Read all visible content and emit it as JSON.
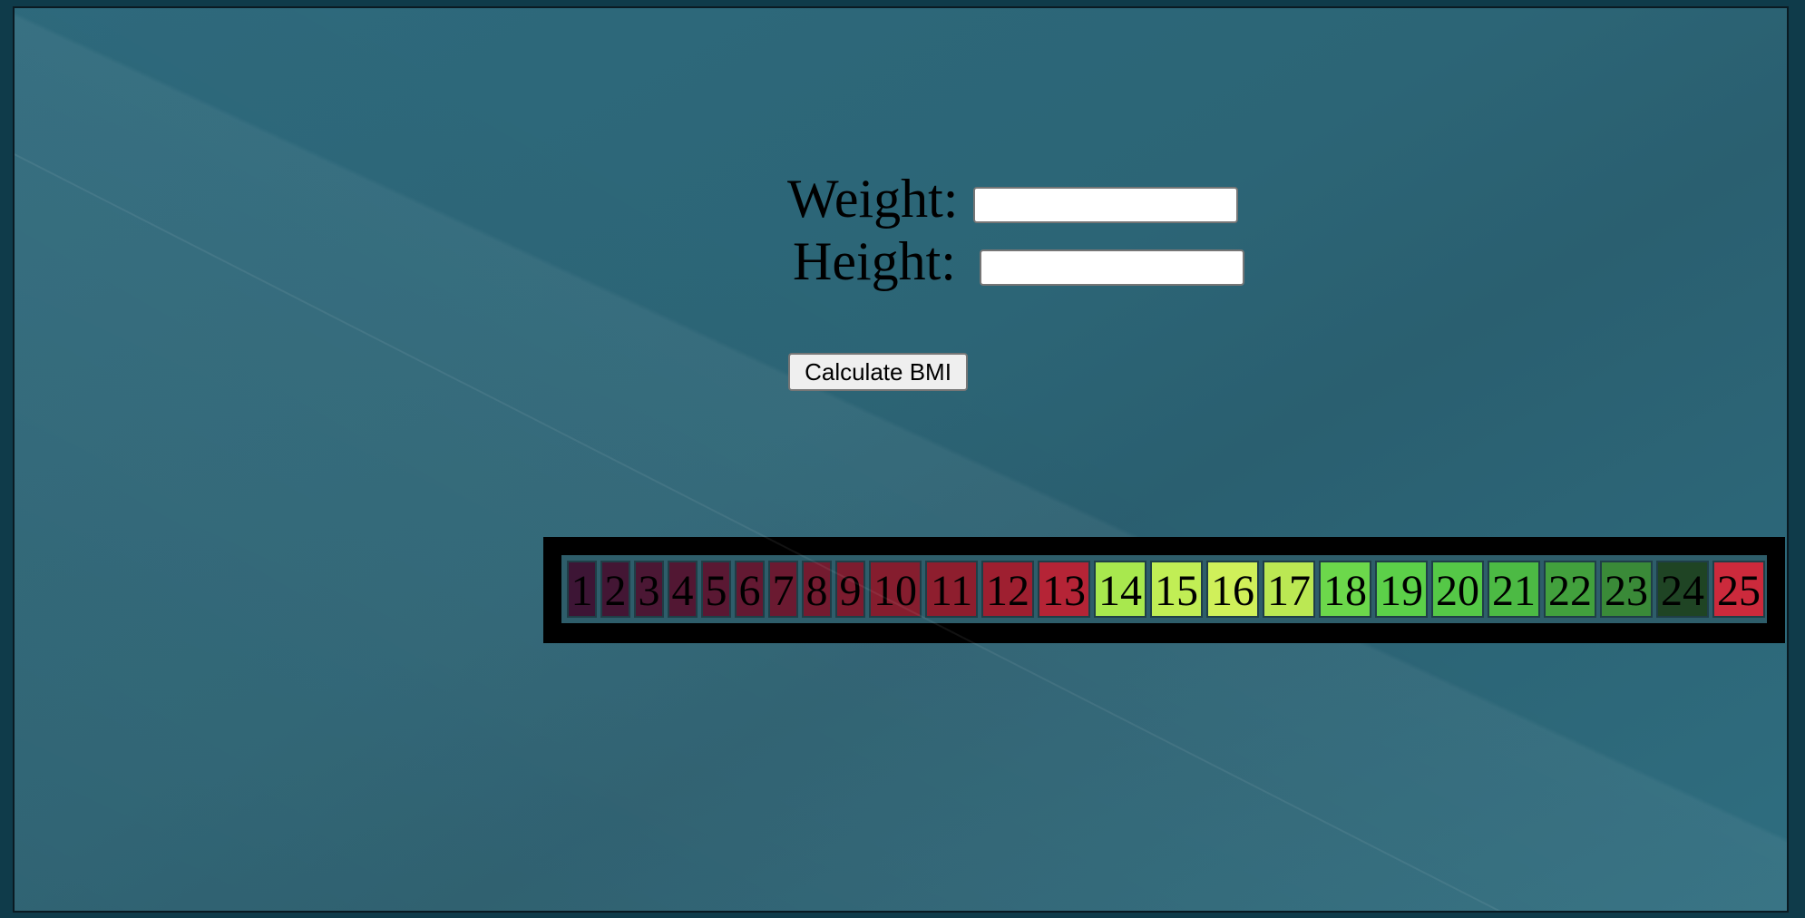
{
  "form": {
    "weight_label": "Weight:",
    "height_label": "Height:",
    "weight_value": "",
    "height_value": "",
    "calculate_label": "Calculate BMI"
  },
  "scale": {
    "cells": [
      {
        "label": "1",
        "color": "#3d1535"
      },
      {
        "label": "2",
        "color": "#431634"
      },
      {
        "label": "3",
        "color": "#4b1734"
      },
      {
        "label": "4",
        "color": "#521733"
      },
      {
        "label": "5",
        "color": "#5a1833"
      },
      {
        "label": "6",
        "color": "#631932"
      },
      {
        "label": "7",
        "color": "#6b1a31"
      },
      {
        "label": "8",
        "color": "#741b30"
      },
      {
        "label": "9",
        "color": "#7c1c2f"
      },
      {
        "label": "10",
        "color": "#851d2e"
      },
      {
        "label": "11",
        "color": "#8e1e2e"
      },
      {
        "label": "12",
        "color": "#9e1f30"
      },
      {
        "label": "13",
        "color": "#b52436"
      },
      {
        "label": "14",
        "color": "#a8e84e"
      },
      {
        "label": "15",
        "color": "#c1ee55"
      },
      {
        "label": "16",
        "color": "#d0f05a"
      },
      {
        "label": "17",
        "color": "#bbe853"
      },
      {
        "label": "18",
        "color": "#6cd84b"
      },
      {
        "label": "19",
        "color": "#5cd049"
      },
      {
        "label": "20",
        "color": "#55c847"
      },
      {
        "label": "21",
        "color": "#4cba44"
      },
      {
        "label": "22",
        "color": "#42a03d"
      },
      {
        "label": "23",
        "color": "#3a8a38"
      },
      {
        "label": "24",
        "color": "#1f4424"
      },
      {
        "label": "25",
        "color": "#cc2a3c"
      }
    ]
  }
}
